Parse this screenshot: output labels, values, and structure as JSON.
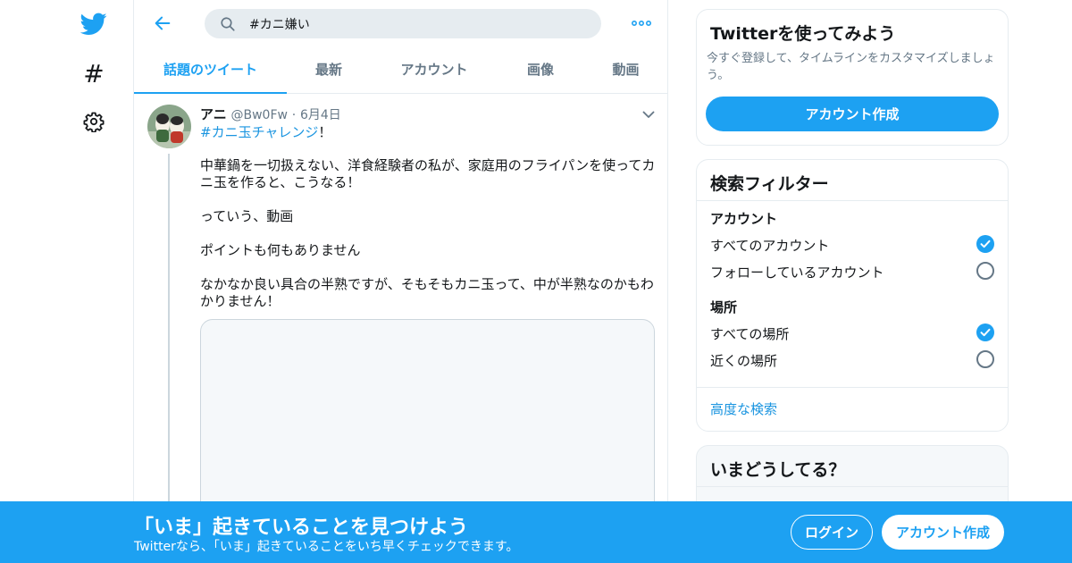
{
  "colors": {
    "accent": "#1da1f2",
    "link": "#1b95e0",
    "muted": "#657786",
    "border": "#e6ecf0"
  },
  "leftnav": {
    "icons": [
      "twitter-bird-icon",
      "hashtag-icon",
      "gear-icon"
    ],
    "hash_glyph": "#"
  },
  "search": {
    "query": "#カニ嫌い"
  },
  "tabs": [
    {
      "label": "話題のツイート",
      "active": true
    },
    {
      "label": "最新"
    },
    {
      "label": "アカウント"
    },
    {
      "label": "画像"
    },
    {
      "label": "動画"
    }
  ],
  "tweet": {
    "name": "アニ",
    "handle": "@Bw0Fw",
    "sep": "·",
    "date": "6月4日",
    "hashtag": "#カニ玉チャレンジ",
    "hashtag_suffix": "！",
    "paragraphs": [
      "中華鍋を一切扱えない、洋食経験者の私が、家庭用のフライパンを使ってカニ玉を作ると、こうなる！",
      "っていう、動画",
      "ポイントも何もありません",
      "なかなか良い具合の半熟ですが、そもそもカニ玉って、中が半熟なのかもわかりません！"
    ]
  },
  "signup_card": {
    "title": "Twitterを使ってみよう",
    "desc": "今すぐ登録して、タイムラインをカスタマイズしましょう。",
    "button": "アカウント作成"
  },
  "filters": {
    "title": "検索フィルター",
    "account_heading": "アカウント",
    "account_options": [
      {
        "label": "すべてのアカウント",
        "selected": true
      },
      {
        "label": "フォローしているアカウント",
        "selected": false
      }
    ],
    "place_heading": "場所",
    "place_options": [
      {
        "label": "すべての場所",
        "selected": true
      },
      {
        "label": "近くの場所",
        "selected": false
      }
    ],
    "advanced": "高度な検索"
  },
  "trends": {
    "title": "いまどうしてる？"
  },
  "banner": {
    "title": "「いま」起きていることを見つけよう",
    "subtitle": "Twitterなら、「いま」起きていることをいち早くチェックできます。",
    "login": "ログイン",
    "signup": "アカウント作成"
  }
}
